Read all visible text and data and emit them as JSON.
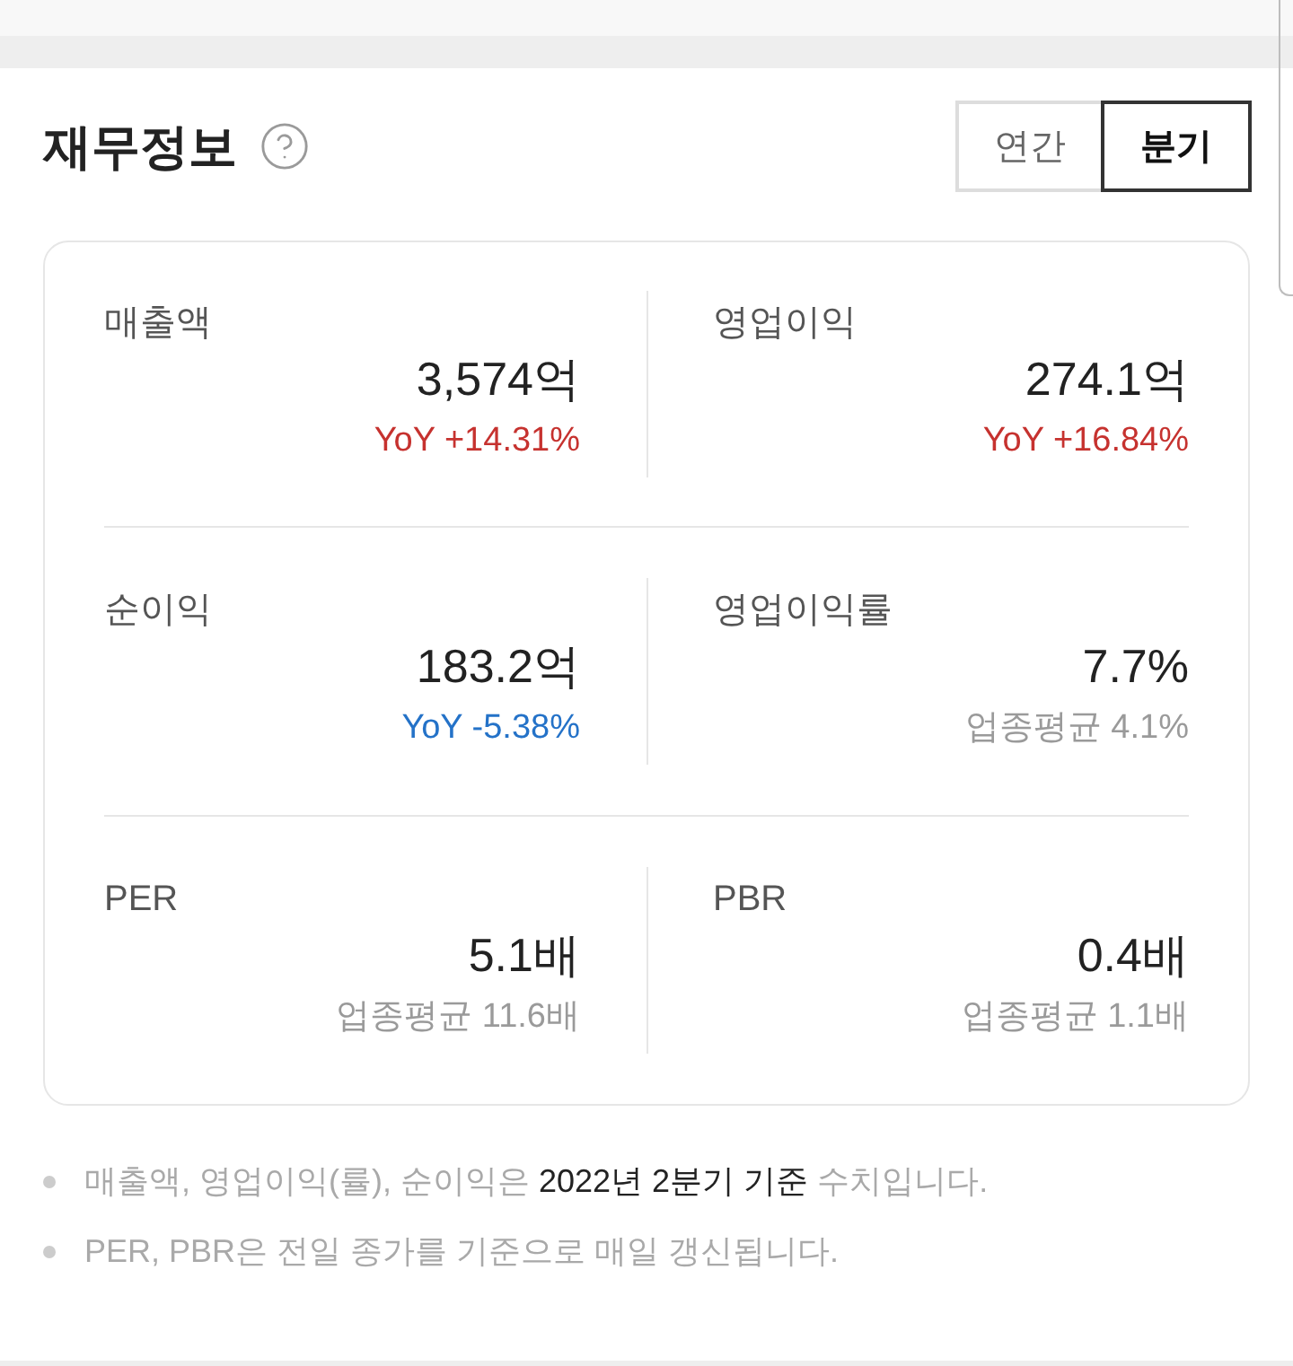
{
  "header": {
    "title": "재무정보",
    "period_tabs": [
      {
        "label": "연간",
        "selected": false
      },
      {
        "label": "분기",
        "selected": true
      }
    ]
  },
  "metric_rows": [
    [
      {
        "label": "매출액",
        "value": "3,574억",
        "note": {
          "text": "YoY +14.31%",
          "kind": "increase"
        }
      },
      {
        "label": "영업이익",
        "value": "274.1억",
        "note": {
          "text": "YoY +16.84%",
          "kind": "increase"
        }
      }
    ],
    [
      {
        "label": "순이익",
        "value": "183.2억",
        "note": {
          "text": "YoY -5.38%",
          "kind": "decrease"
        }
      },
      {
        "label": "영업이익률",
        "value": "7.7%",
        "note": {
          "text": "업종평균 4.1%",
          "kind": "average"
        }
      }
    ],
    [
      {
        "label": "PER",
        "value": "5.1배",
        "note": {
          "text": "업종평균 11.6배",
          "kind": "average"
        }
      },
      {
        "label": "PBR",
        "value": "0.4배",
        "note": {
          "text": "업종평균 1.1배",
          "kind": "average"
        }
      }
    ]
  ],
  "notes": [
    {
      "parts": [
        {
          "text": "매출액, 영업이익(률), 순이익은 ",
          "emphasis": false
        },
        {
          "text": "2022년 2분기 기준",
          "emphasis": true
        },
        {
          "text": " 수치입니다.",
          "emphasis": false
        }
      ]
    },
    {
      "parts": [
        {
          "text": "PER, PBR은 전일 종가를 기준으로 매일 갱신됩니다.",
          "emphasis": false
        }
      ]
    }
  ]
}
